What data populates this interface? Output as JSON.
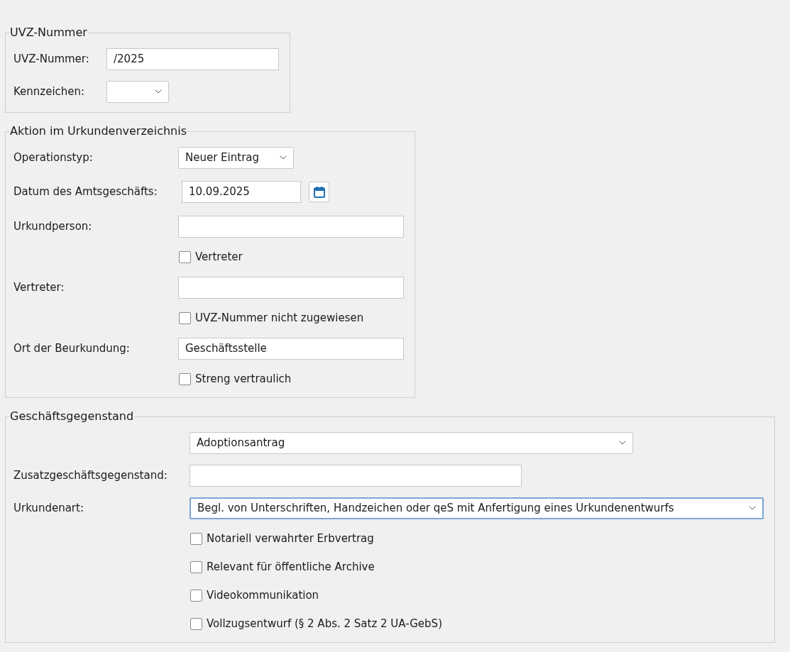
{
  "sections": [
    {
      "title": "UVZ-Nummer",
      "rows": [
        {
          "kind": "text",
          "label": "UVZ-Nummer:",
          "value": "/2025",
          "focused": false
        },
        {
          "kind": "select",
          "label": "Kennzeichen:",
          "value": "",
          "focused": false
        }
      ]
    },
    {
      "title": "Aktion im Urkundenverzeichnis",
      "rows": [
        {
          "kind": "select",
          "label": "Operationstyp:",
          "value": "Neuer Eintrag",
          "focused": false
        },
        {
          "kind": "date",
          "label": "Datum des Amtsgeschäfts:",
          "value": "10.09.2025",
          "focused": false
        },
        {
          "kind": "text",
          "label": "Urkundperson:",
          "value": "",
          "focused": false
        },
        {
          "kind": "checkbox",
          "label": "Vertreter",
          "checked": false
        },
        {
          "kind": "text",
          "label": "Vertreter:",
          "value": "",
          "focused": false
        },
        {
          "kind": "checkbox",
          "label": "UVZ-Nummer nicht zugewiesen",
          "checked": false
        },
        {
          "kind": "text",
          "label": "Ort der Beurkundung:",
          "value": "Geschäftsstelle",
          "focused": false
        },
        {
          "kind": "checkbox",
          "label": "Streng vertraulich",
          "checked": false
        }
      ]
    },
    {
      "title": "Geschäftsgegenstand",
      "rows": [
        {
          "kind": "select",
          "value": "Adoptionsantrag",
          "focused": false
        },
        {
          "kind": "text",
          "label": "Zusatzgeschäftsgegenstand:",
          "value": "",
          "focused": false
        },
        {
          "kind": "select",
          "label": "Urkundenart:",
          "value": "Begl. von Unterschriften, Handzeichen oder qeS mit Anfertigung eines Urkundenentwurfs",
          "focused": true
        },
        {
          "kind": "checkbox",
          "label": "Notariell verwahrter Erbvertrag",
          "checked": false
        },
        {
          "kind": "checkbox",
          "label": "Relevant für öffentliche Archive",
          "checked": false
        },
        {
          "kind": "checkbox",
          "label": "Videokommunikation",
          "checked": false
        },
        {
          "kind": "checkbox",
          "label": "Vollzugsentwurf (§ 2 Abs. 2 Satz 2 UA-GebS)",
          "checked": false
        }
      ]
    }
  ]
}
